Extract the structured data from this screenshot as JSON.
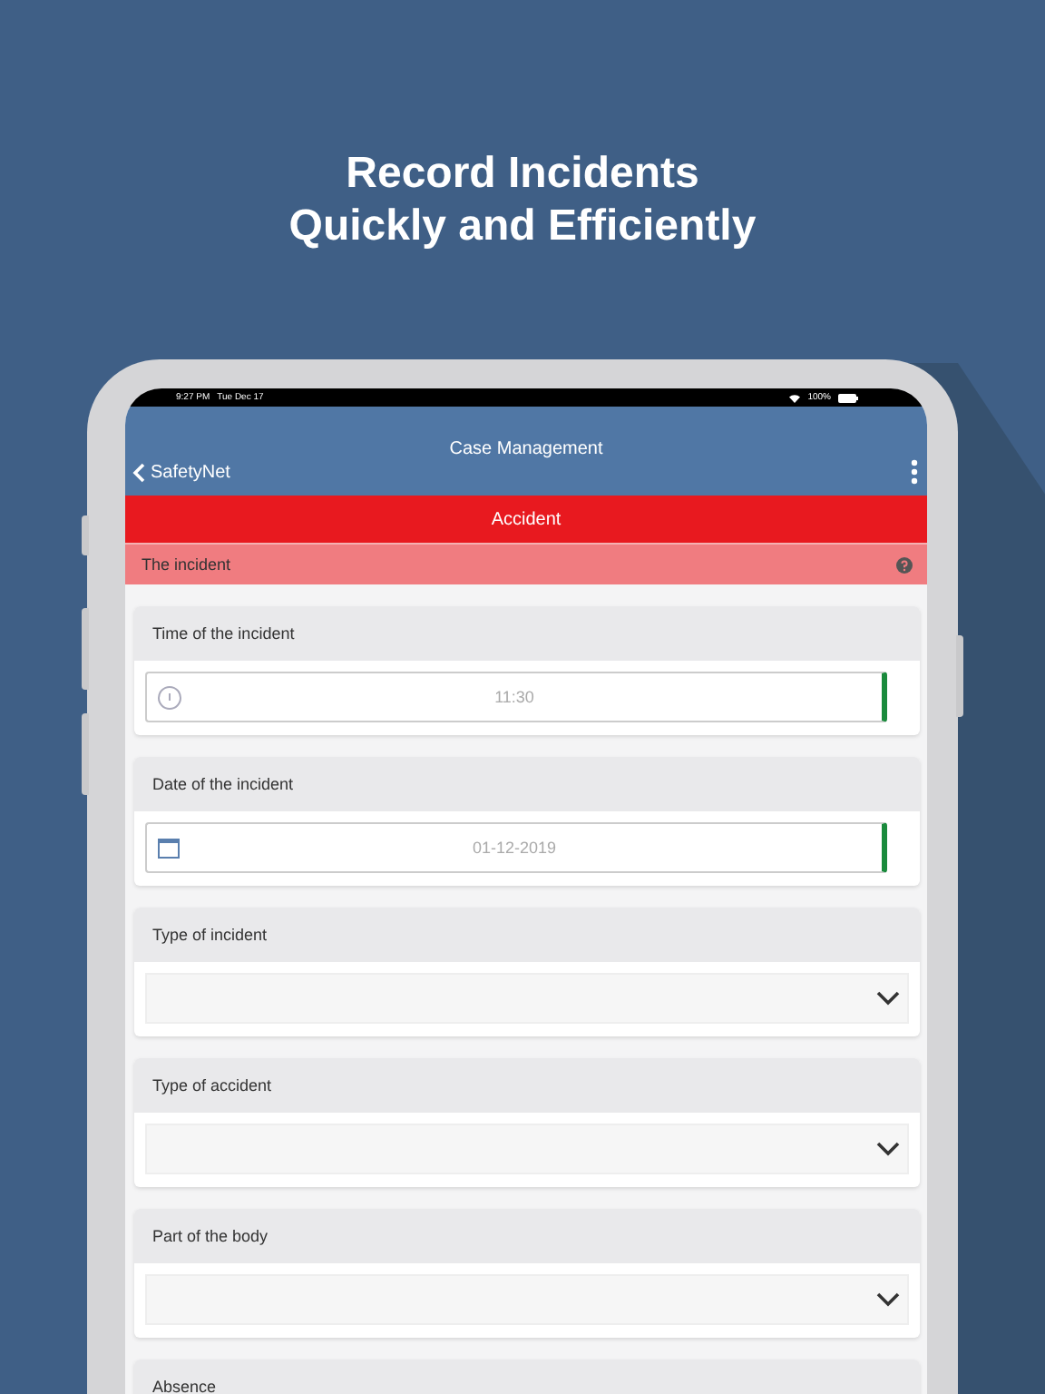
{
  "headline": [
    "Record Incidents",
    "Quickly and Efficiently"
  ],
  "status_bar": {
    "time": "9:27 PM",
    "date": "Tue Dec 17",
    "battery": "100%"
  },
  "nav": {
    "back": "SafetyNet",
    "title": "Case Management"
  },
  "banner": "Accident",
  "section": "The incident",
  "fields": [
    {
      "label": "Time of the incident",
      "kind": "time",
      "value": "11:30",
      "valid": true
    },
    {
      "label": "Date of the incident",
      "kind": "date",
      "value": "01-12-2019",
      "valid": true
    },
    {
      "label": "Type of incident",
      "kind": "select"
    },
    {
      "label": "Type of accident",
      "kind": "select"
    },
    {
      "label": "Part of the body",
      "kind": "select"
    },
    {
      "label": "Absence",
      "kind": "cut"
    }
  ]
}
